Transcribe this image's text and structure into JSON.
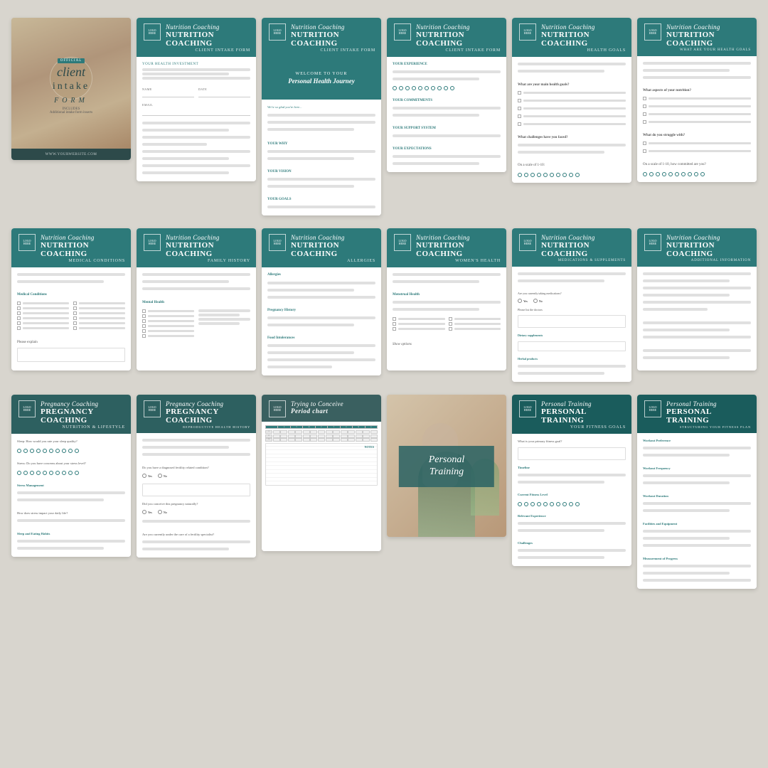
{
  "background": "#d8d5ce",
  "rows": [
    {
      "id": "row1",
      "cards": [
        {
          "type": "cover",
          "official_text": "OFFICIAL",
          "main_title": "client",
          "subtitle1": "intake",
          "subtitle2": "FORM",
          "includes": "INCLUDES",
          "includes_detail": "Additional intake form inserts",
          "footer_text": "WWW.YOURWEBSITE.COM"
        },
        {
          "type": "standard",
          "header": {
            "category_italic": "Nutrition Coaching",
            "category_bold": "Nutrition Coaching",
            "subtitle": "CLIENT INTAKE FORM"
          }
        },
        {
          "type": "welcome",
          "header": {
            "category_italic": "Nutrition Coaching",
            "subtitle": "CLIENT INTAKE FORM"
          },
          "banner_title": "WELCOME TO YOUR",
          "banner_main": "Personal Health Journey"
        },
        {
          "type": "standard",
          "header": {
            "category_italic": "Nutrition Coaching",
            "subtitle": "CLIENT INTAKE FORM"
          },
          "sections": [
            "Your Experience",
            "Your Commitments",
            "Your Why",
            "Your Vision",
            "Your Goals",
            "Your Support System",
            "Your Expectations"
          ]
        },
        {
          "type": "standard",
          "header": {
            "category_italic": "Nutrition Coaching",
            "subtitle": "HEALTH GOALS"
          }
        },
        {
          "type": "standard",
          "header": {
            "category_italic": "Nutrition Coaching",
            "subtitle": "WHAT ARE YOUR HEALTH GOALS"
          }
        }
      ]
    },
    {
      "id": "row2",
      "cards": [
        {
          "type": "standard",
          "header": {
            "category_italic": "Nutrition Coaching",
            "subtitle": "MEDICAL CONDITIONS"
          }
        },
        {
          "type": "standard",
          "header": {
            "category_italic": "Nutrition Coaching",
            "subtitle": "FAMILY HISTORY"
          }
        },
        {
          "type": "standard",
          "header": {
            "category_italic": "Nutrition Coaching",
            "subtitle": "ALLERGIES"
          }
        },
        {
          "type": "standard",
          "header": {
            "category_italic": "Nutrition Coaching",
            "subtitle": "WOMEN'S HEALTH"
          }
        },
        {
          "type": "standard",
          "header": {
            "category_italic": "Nutrition Coaching",
            "subtitle": "MEDICATIONS & SUPPLEMENTS"
          }
        },
        {
          "type": "standard",
          "header": {
            "category_italic": "Nutrition Coaching",
            "subtitle": "ADDITIONAL INFORMATION"
          }
        }
      ]
    },
    {
      "id": "row3",
      "cards": [
        {
          "type": "standard",
          "header": {
            "category_italic": "Pregnancy Coaching",
            "subtitle": "NUTRITION & LIFESTYLE"
          }
        },
        {
          "type": "standard",
          "header": {
            "category_italic": "Pregnancy Coaching",
            "subtitle": "REPRODUCTIVE HEALTH HISTORY"
          }
        },
        {
          "type": "standard",
          "header": {
            "category_italic": "Trying to Conceive",
            "bold_subtitle": "Period chart"
          }
        },
        {
          "type": "photo",
          "overlay_title": "Personal",
          "overlay_title2": "Training"
        },
        {
          "type": "standard",
          "header": {
            "category_italic": "Personal Training",
            "subtitle": "YOUR FITNESS GOALS"
          }
        },
        {
          "type": "standard",
          "header": {
            "category_italic": "Personal Training",
            "subtitle": "STRUCTURING YOUR FITNESS PLAN"
          }
        }
      ]
    }
  ],
  "labels": {
    "coaching_label": "Coaching",
    "nutrition_coaching": "Nutrition Coaching",
    "pregnancy_coaching": "Pregnancy Coaching",
    "personal_training": "Personal Training",
    "training_label": "Training"
  }
}
